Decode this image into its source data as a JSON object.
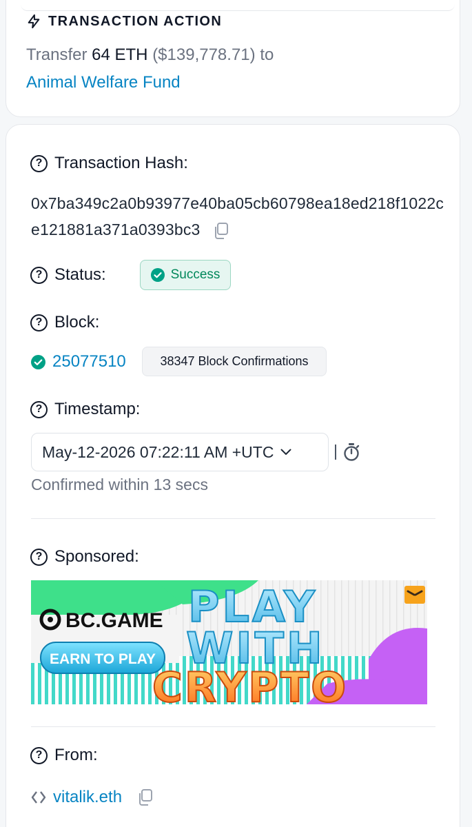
{
  "action": {
    "title": "TRANSACTION ACTION",
    "verb": "Transfer",
    "amount": "64 ETH",
    "usd": "($139,778.71)",
    "preposition": "to",
    "recipient": "Animal Welfare Fund"
  },
  "details": {
    "hash_label": "Transaction Hash:",
    "hash_value": "0x7ba349c2a0b93977e40ba05cb60798ea18ed218f1022ce121881a371a0393bc3",
    "status_label": "Status:",
    "status_value": "Success",
    "block_label": "Block:",
    "block_number": "25077510",
    "block_confirmations": "38347 Block Confirmations",
    "timestamp_label": "Timestamp:",
    "timestamp_value": "May-12-2026 07:22:11 AM +UTC",
    "confirmed_text": "Confirmed within 13 secs",
    "sponsored_label": "Sponsored:",
    "from_label": "From:",
    "from_value": "vitalik.eth"
  },
  "ad": {
    "brand": "BC.GAME",
    "cta": "EARN TO PLAY",
    "headline": [
      "PLAY",
      "WITH",
      "CRYPTO"
    ]
  },
  "colors": {
    "link": "#0784c3",
    "success": "#00a186",
    "success_bg": "#e6f6f1",
    "ad_green": "#3ee08a",
    "ad_purple": "#c561f5"
  },
  "icons": [
    "bolt-icon",
    "question-circle-icon",
    "copy-icon",
    "check-circle-icon",
    "chevron-down-icon",
    "stopwatch-icon",
    "contract-icon"
  ]
}
